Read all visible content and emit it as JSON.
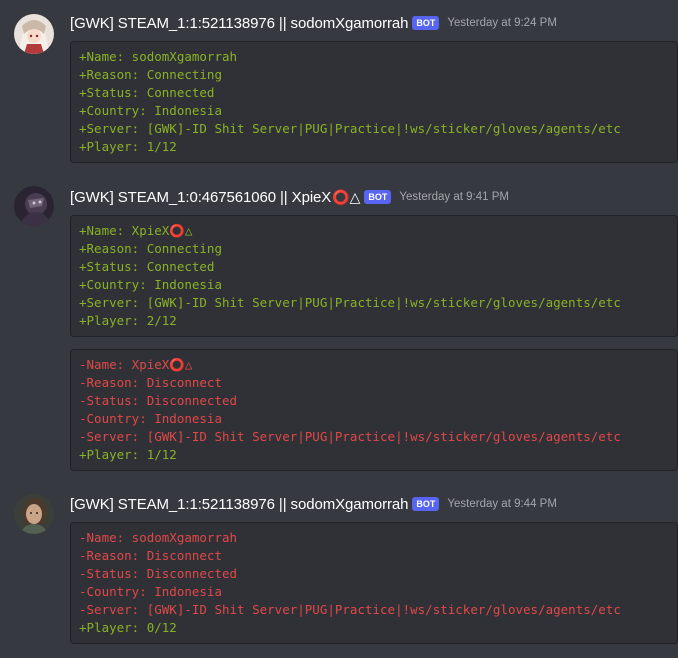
{
  "messages": [
    {
      "username": "[GWK] STEAM_1:1:521138976 || sodomXgamorrah",
      "bot_tag": "BOT",
      "timestamp": "Yesterday at 9:24 PM",
      "avatar_icon": "avatar-anime-girl-icon",
      "blocks": [
        {
          "lines": [
            {
              "text": "+Name: sodomXgamorrah",
              "kind": "plus"
            },
            {
              "text": "+Reason: Connecting",
              "kind": "plus"
            },
            {
              "text": "+Status: Connected",
              "kind": "plus"
            },
            {
              "text": "+Country: Indonesia",
              "kind": "plus"
            },
            {
              "text": "+Server: [GWK]-ID Shit Server|PUG|Practice|!ws/sticker/gloves/agents/etc",
              "kind": "plus"
            },
            {
              "text": "+Player: 1/12",
              "kind": "plus"
            }
          ]
        }
      ]
    },
    {
      "username": "[GWK] STEAM_1:0:467561060 || XpieX",
      "username_emoji": {
        "circle": "⭕",
        "triangle": "△"
      },
      "bot_tag": "BOT",
      "timestamp": "Yesterday at 9:41 PM",
      "avatar_icon": "avatar-dark-figure-icon",
      "blocks": [
        {
          "lines": [
            {
              "text": "+Name: XpieX",
              "kind": "plus",
              "emoji": true
            },
            {
              "text": "+Reason: Connecting",
              "kind": "plus"
            },
            {
              "text": "+Status: Connected",
              "kind": "plus"
            },
            {
              "text": "+Country: Indonesia",
              "kind": "plus"
            },
            {
              "text": "+Server: [GWK]-ID Shit Server|PUG|Practice|!ws/sticker/gloves/agents/etc",
              "kind": "plus"
            },
            {
              "text": "+Player: 2/12",
              "kind": "plus"
            }
          ]
        },
        {
          "lines": [
            {
              "text": "-Name: XpieX",
              "kind": "minus",
              "emoji": true
            },
            {
              "text": "-Reason: Disconnect",
              "kind": "minus"
            },
            {
              "text": "-Status: Disconnected",
              "kind": "minus"
            },
            {
              "text": "-Country: Indonesia",
              "kind": "minus"
            },
            {
              "text": "-Server: [GWK]-ID Shit Server|PUG|Practice|!ws/sticker/gloves/agents/etc",
              "kind": "minus"
            },
            {
              "text": "+Player: 1/12",
              "kind": "plus"
            }
          ]
        }
      ]
    },
    {
      "username": "[GWK] STEAM_1:1:521138976 || sodomXgamorrah",
      "bot_tag": "BOT",
      "timestamp": "Yesterday at 9:44 PM",
      "avatar_icon": "avatar-portrait-icon",
      "blocks": [
        {
          "lines": [
            {
              "text": "-Name: sodomXgamorrah",
              "kind": "minus"
            },
            {
              "text": "-Reason: Disconnect",
              "kind": "minus"
            },
            {
              "text": "-Status: Disconnected",
              "kind": "minus"
            },
            {
              "text": "-Country: Indonesia",
              "kind": "minus"
            },
            {
              "text": "-Server: [GWK]-ID Shit Server|PUG|Practice|!ws/sticker/gloves/agents/etc",
              "kind": "minus"
            },
            {
              "text": "+Player: 0/12",
              "kind": "plus"
            }
          ]
        }
      ]
    }
  ],
  "colors": {
    "background": "#36393f",
    "codeblock_bg": "#2f3136",
    "diff_plus": "#8ab126",
    "diff_minus": "#e04848",
    "bot_tag": "#5865f2",
    "timestamp": "#a3a6aa"
  }
}
